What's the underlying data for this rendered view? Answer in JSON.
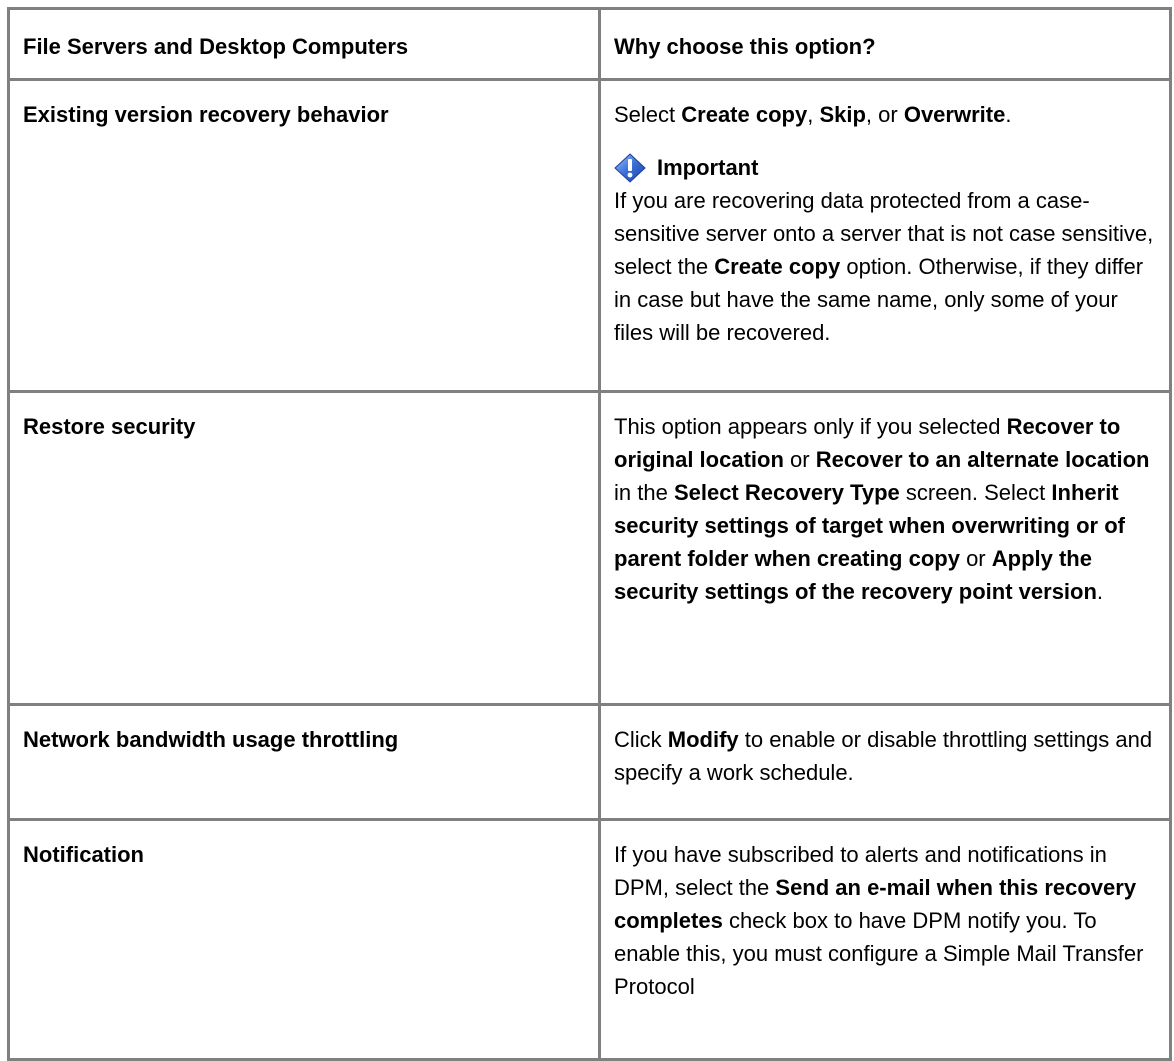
{
  "table": {
    "header": {
      "col1": "File Servers and Desktop Computers",
      "col2": "Why choose this option?"
    },
    "rows": [
      {
        "label": "Existing version recovery behavior",
        "desc": [
          {
            "t": "Select ",
            "b": false
          },
          {
            "t": "Create copy",
            "b": true
          },
          {
            "t": ", ",
            "b": false
          },
          {
            "t": "Skip",
            "b": true
          },
          {
            "t": ", or ",
            "b": false
          },
          {
            "t": "Overwrite",
            "b": true
          },
          {
            "t": ".",
            "b": false
          }
        ],
        "note": {
          "icon": "important-icon",
          "title": "Important",
          "body": [
            {
              "t": "If you are recovering data protected from a case-sensitive server onto a server that is not case sensitive, select the ",
              "b": false
            },
            {
              "t": "Create copy",
              "b": true
            },
            {
              "t": " option. Otherwise, if they differ in case but have the same name, only some of your files will be recovered.",
              "b": false
            }
          ]
        }
      },
      {
        "label": "Restore security",
        "desc": [
          {
            "t": "This option appears only if you selected ",
            "b": false
          },
          {
            "t": "Recover to original location",
            "b": true
          },
          {
            "t": " or ",
            "b": false
          },
          {
            "t": "Recover to an alternate location",
            "b": true
          },
          {
            "t": " in the ",
            "b": false
          },
          {
            "t": "Select Recovery Type",
            "b": true
          },
          {
            "t": " screen. Select ",
            "b": false
          },
          {
            "t": "Inherit security settings of target when overwriting or of parent folder when creating copy",
            "b": true
          },
          {
            "t": " or ",
            "b": false
          },
          {
            "t": "Apply the security settings of the recovery point version",
            "b": true
          },
          {
            "t": ".",
            "b": false
          }
        ]
      },
      {
        "label": "Network bandwidth usage throttling",
        "desc": [
          {
            "t": "Click ",
            "b": false
          },
          {
            "t": "Modify",
            "b": true
          },
          {
            "t": " to enable or disable throttling settings and specify a work schedule.",
            "b": false
          }
        ]
      },
      {
        "label": "Notification",
        "desc": [
          {
            "t": "If you have subscribed to alerts and notifications in DPM, select the ",
            "b": false
          },
          {
            "t": "Send an e-mail when this recovery completes",
            "b": true
          },
          {
            "t": " check box to have DPM notify you. To enable this, you must configure a Simple Mail Transfer Protocol",
            "b": false
          }
        ]
      }
    ]
  },
  "colors": {
    "border": "#808080",
    "icon_blue": "#3a6fd8",
    "text": "#000000"
  }
}
